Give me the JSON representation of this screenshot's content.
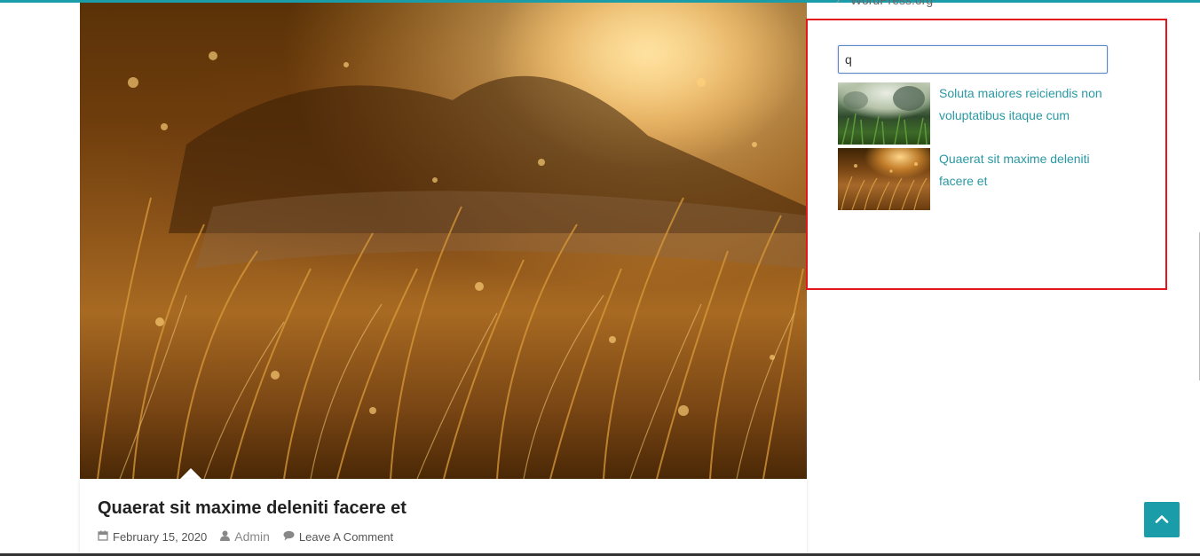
{
  "sidebar": {
    "prev_widget_link": "WordPress.org",
    "search": {
      "value": "q",
      "placeholder": ""
    },
    "results": [
      {
        "title": "Soluta maiores reiciendis non voluptatibus itaque cum",
        "thumb": "grass-photo"
      },
      {
        "title": "Quaerat sit maxime deleniti facere et",
        "thumb": "golden-field-photo"
      }
    ]
  },
  "post": {
    "title": "Quaerat sit maxime deleniti facere et",
    "date": "February 15, 2020",
    "author": "Admin",
    "comments": "Leave A Comment",
    "image": "golden-field-photo"
  },
  "icons": {
    "date": "calendar-icon",
    "author": "user-icon",
    "comments": "comment-icon",
    "back_to_top": "chevron-up-icon",
    "list_bullet": "chevron-right-icon"
  },
  "colors": {
    "accent": "#1a9da8",
    "link": "#2a98a3",
    "highlight_box": "#e5161b",
    "search_focus": "#5b87c9"
  }
}
